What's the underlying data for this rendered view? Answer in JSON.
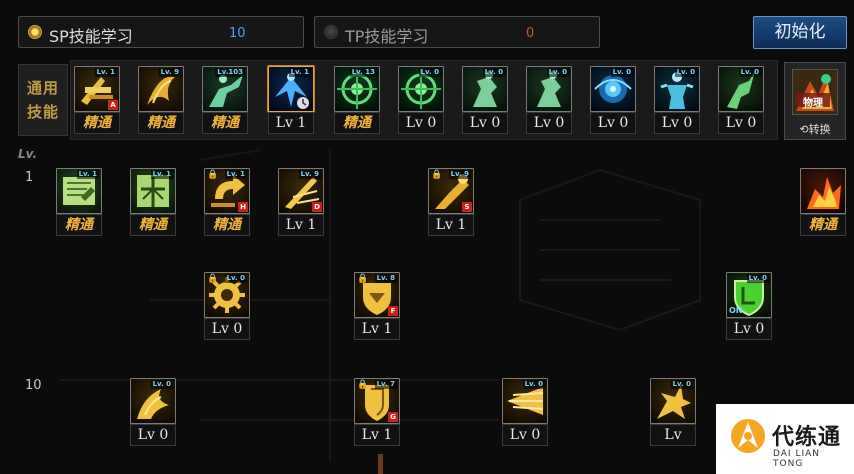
{
  "top_bar": {
    "sp_tab": {
      "label": "SP技能学习",
      "count": "10",
      "count_color": "#4aa0ff"
    },
    "tp_tab": {
      "label": "TP技能学习",
      "count": "0",
      "count_color": "#e0502a"
    },
    "reset_button": "初始化"
  },
  "common": {
    "label_line1": "通用",
    "label_line2": "技能",
    "slots": [
      {
        "icon": "arrow-shot-icon",
        "lv": "Lv. 1",
        "badge": "A",
        "caption": "精通",
        "mastered": true
      },
      {
        "icon": "arrow-burst-icon",
        "lv": "Lv. 9",
        "caption": "精通",
        "mastered": true
      },
      {
        "icon": "kick-silhouette-icon",
        "lv": "Lv.103",
        "caption": "精通",
        "mastered": true
      },
      {
        "icon": "winged-figure-icon",
        "lv": "Lv. 1",
        "caption": "Lv 1",
        "selected": true
      },
      {
        "icon": "green-target-icon",
        "lv": "Lv. 13",
        "caption": "精通",
        "mastered": true
      },
      {
        "icon": "green-target-icon",
        "lv": "Lv. 0",
        "caption": "Lv 0"
      },
      {
        "icon": "dodge-figure-icon",
        "lv": "Lv. 0",
        "caption": "Lv 0"
      },
      {
        "icon": "dodge-figure-icon",
        "lv": "Lv. 0",
        "caption": "Lv 0"
      },
      {
        "icon": "blue-eye-icon",
        "lv": "Lv. 0",
        "caption": "Lv 0"
      },
      {
        "icon": "ice-body-icon",
        "lv": "Lv. 0",
        "caption": "Lv 0"
      },
      {
        "icon": "green-leap-icon",
        "lv": "Lv. 0",
        "caption": "Lv 0"
      }
    ],
    "switch": {
      "icon_text": "物理",
      "label": "转换"
    }
  },
  "tree": {
    "header": "Lv.",
    "row_levels": [
      "1",
      "10"
    ],
    "row1": [
      {
        "icon": "green-scroll-icon",
        "lv": "Lv. 1",
        "caption": "精通",
        "mastered": true
      },
      {
        "icon": "green-book-icon",
        "lv": "Lv. 1",
        "caption": "精通",
        "mastered": true
      },
      {
        "icon": "gold-arrow-turn-icon",
        "lv": "Lv. 1",
        "lock": true,
        "badge": "H",
        "caption": "精通",
        "mastered": true
      },
      {
        "icon": "gold-wave-icon",
        "lv": "Lv. 9",
        "badge": "D",
        "caption": "Lv 1"
      },
      {
        "icon": "gold-kick-icon",
        "lv": "Lv. 9",
        "lock": true,
        "badge": "S",
        "caption": "Lv 1"
      },
      {
        "icon": "fire-burst-icon",
        "lv": "",
        "caption": "精通",
        "mastered": true
      }
    ],
    "row2": [
      {
        "icon": "gold-gear-icon",
        "lv": "Lv. 0",
        "lock": true,
        "caption": "Lv 0"
      },
      {
        "icon": "gold-shield-icon",
        "lv": "Lv. 8",
        "lock": true,
        "badge": "F",
        "caption": "Lv 1"
      },
      {
        "icon": "green-shield-icon",
        "lv": "Lv. 0",
        "on": "ON",
        "caption": "Lv 0"
      }
    ],
    "row3": [
      {
        "icon": "gold-flame-icon",
        "lv": "Lv. 0",
        "caption": "Lv 0"
      },
      {
        "icon": "gold-badge-icon",
        "lv": "Lv. 7",
        "lock": true,
        "badge": "G",
        "caption": "Lv 1"
      },
      {
        "icon": "gold-beam-icon",
        "lv": "Lv. 0",
        "caption": "Lv 0"
      },
      {
        "icon": "gold-impact-icon",
        "lv": "Lv. 0",
        "caption": "Lv"
      }
    ]
  },
  "watermark": {
    "name": "代练通",
    "sub": "DAI LIAN TONG"
  }
}
